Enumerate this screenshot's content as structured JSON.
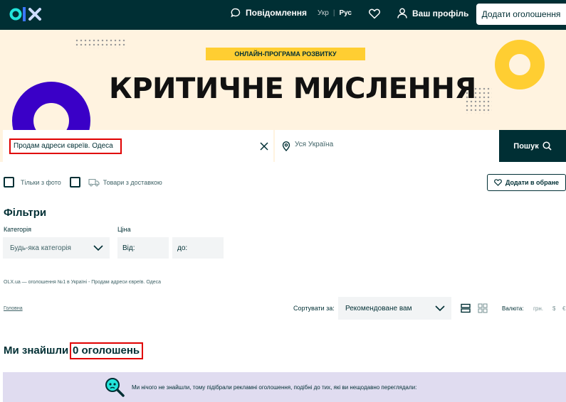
{
  "header": {
    "logo": "olx",
    "messages_label": "Повідомлення",
    "lang_uk": "Укр",
    "lang_sep": "|",
    "lang_ru": "Рус",
    "profile_label": "Ваш профіль",
    "add_ad_label": "Додати оголошення"
  },
  "banner": {
    "tag": "ОНЛАЙН-ПРОГРАМА РОЗВИТКУ",
    "title": "КРИТИЧНЕ МИСЛЕННЯ",
    "colors": {
      "background": "#fff3e0",
      "yellow": "#ffce32",
      "purple": "#3a00c7"
    }
  },
  "search": {
    "query": "Продам адреси євреїв. Одеса",
    "location": "Уся Україна",
    "button_label": "Пошук"
  },
  "options": {
    "photo_only": "Тільки з фото",
    "with_delivery": "Товари з доставкою",
    "add_favorite": "Додати в обране"
  },
  "filters": {
    "title": "Фільтри",
    "category_label": "Категорія",
    "category_value": "Будь-яка категорія",
    "price_label": "Ціна",
    "price_from": "Від:",
    "price_to": "до:"
  },
  "breadcrumb_text": "OLX.ua — оголошення №1 в Україні - Продам адреси євреїв. Одеса",
  "home_link": "Головна",
  "sort": {
    "label": "Сортувати за:",
    "value": "Рекомендоване вам"
  },
  "currency": {
    "label": "Валюта:",
    "uah": "грн.",
    "usd": "$",
    "eur": "€"
  },
  "results": {
    "prefix": "Ми знайшли",
    "count": "0 оголошень"
  },
  "notice": "Ми нічого не знайшли, тому підібрали рекламні оголошення, подібні до тих, які ви нещодавно переглядали:",
  "colors": {
    "header_bg": "#002f34",
    "highlight": "#e00000",
    "notice_bg": "#e0dcf0"
  }
}
